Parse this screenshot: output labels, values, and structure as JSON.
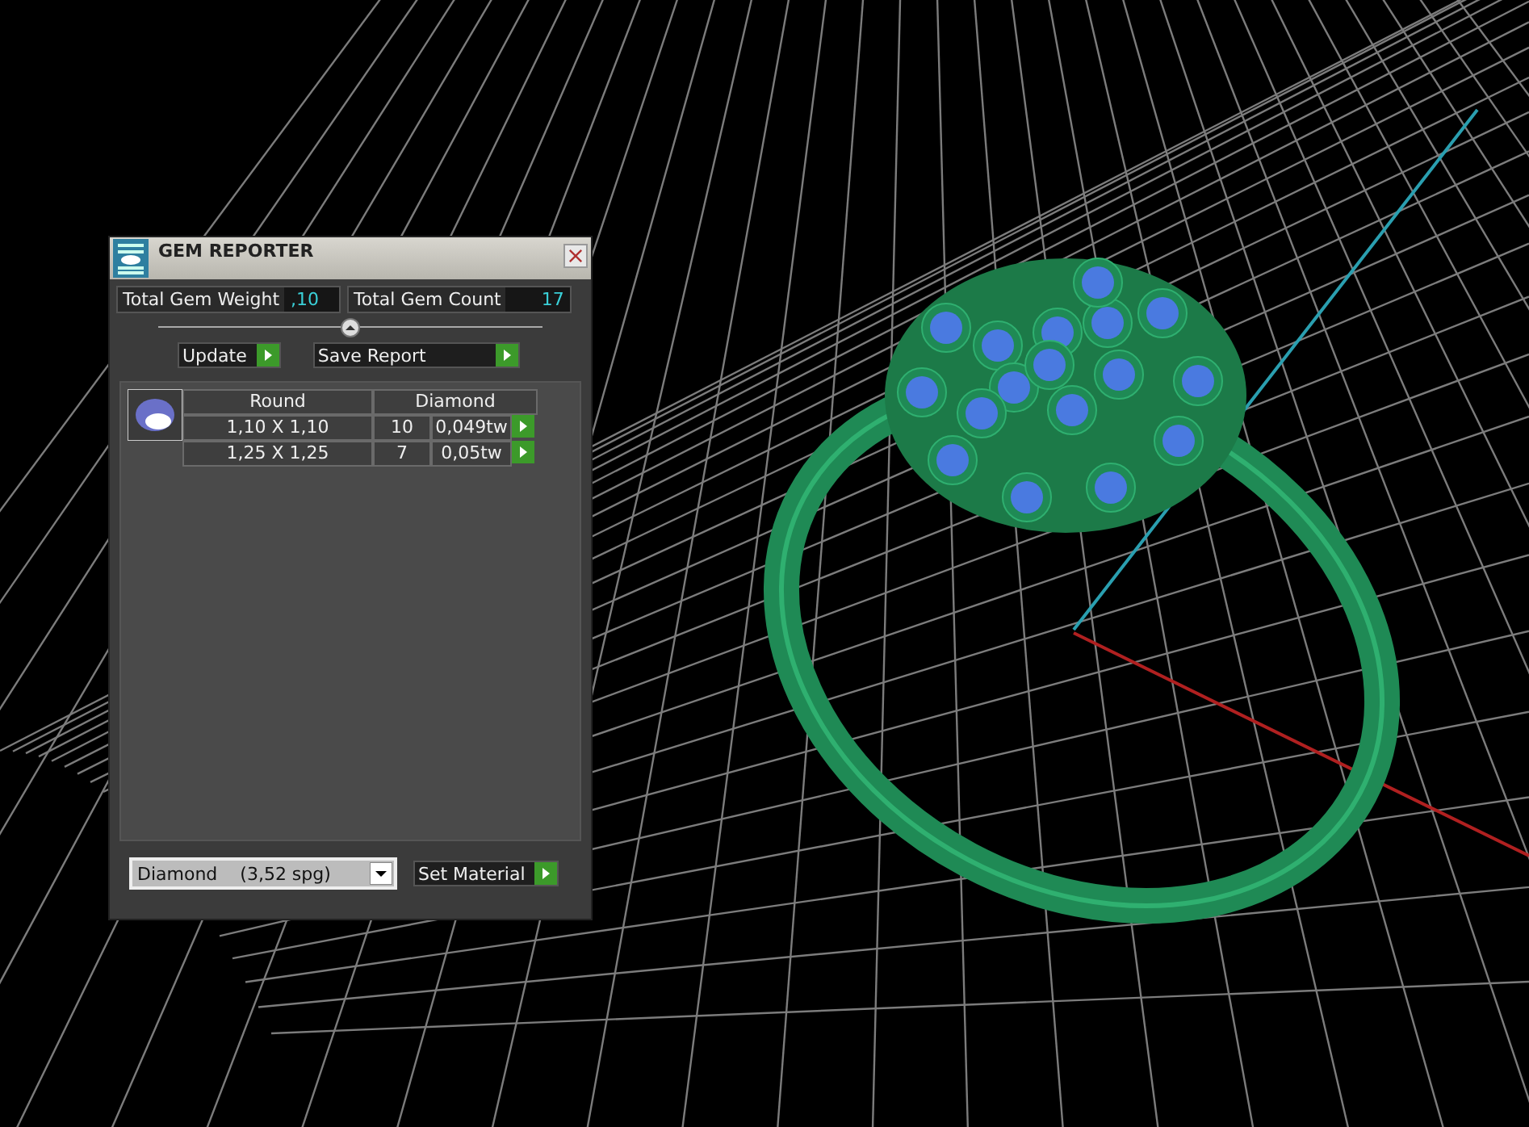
{
  "window": {
    "title": "GEM REPORTER"
  },
  "totals": [
    {
      "label": "Total Gem Weight",
      "value": ",10"
    },
    {
      "label": "Total Gem Count",
      "value": "17"
    }
  ],
  "actions": [
    "Update",
    "Save Report"
  ],
  "table": {
    "columns": [
      "Round",
      "Diamond"
    ],
    "rows": [
      {
        "size": "1,10 X 1,10",
        "count": "10",
        "weight": "0,049tw"
      },
      {
        "size": "1,25 X 1,25",
        "count": "7",
        "weight": "0,05tw"
      }
    ]
  },
  "material": {
    "value": "Diamond    (3,52 spg)"
  },
  "set_material": "Set Material"
}
